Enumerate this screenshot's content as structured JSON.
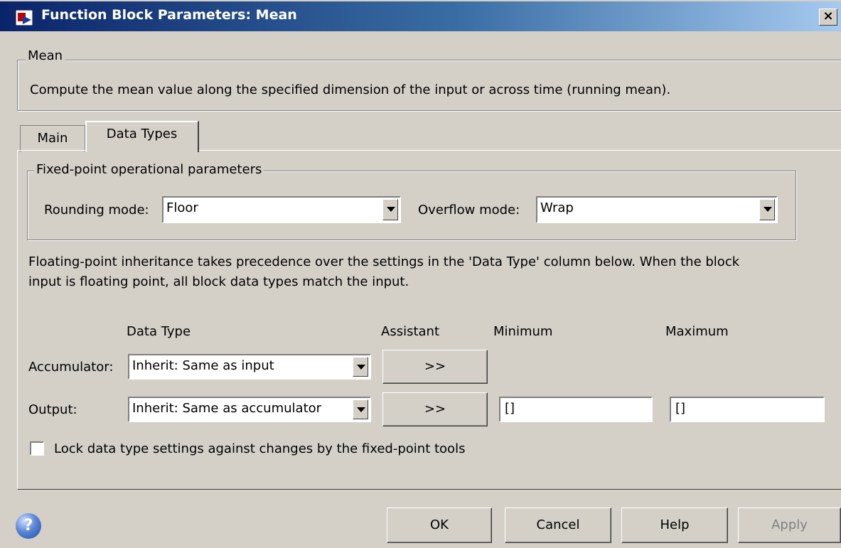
{
  "window": {
    "title": "Function Block Parameters: Mean",
    "close_glyph": "×"
  },
  "description_group": {
    "legend": "Mean",
    "text": "Compute the mean value along the specified dimension of the input or across time (running mean)."
  },
  "tabs": [
    {
      "label": "Main"
    },
    {
      "label": "Data Types"
    }
  ],
  "fixed_point": {
    "legend": "Fixed-point operational parameters",
    "rounding_label": "Rounding mode:",
    "rounding_value": "Floor",
    "overflow_label": "Overflow mode:",
    "overflow_value": "Wrap"
  },
  "info_text_line1": "Floating-point inheritance takes precedence over the settings in the 'Data Type' column below. When the block",
  "info_text_line2": "input is floating point, all block data types match the input.",
  "columns": {
    "data_type": "Data Type",
    "assistant": "Assistant",
    "minimum": "Minimum",
    "maximum": "Maximum"
  },
  "rows": {
    "accumulator": {
      "label": "Accumulator:",
      "data_type": "Inherit: Same as input",
      "assistant": ">>"
    },
    "output": {
      "label": "Output:",
      "data_type": "Inherit: Same as accumulator",
      "assistant": ">>",
      "minimum": "[]",
      "maximum": "[]"
    }
  },
  "lock_checkbox_label": "Lock data type settings against changes by the fixed-point tools",
  "buttons": {
    "help_glyph": "?",
    "ok": "OK",
    "cancel": "Cancel",
    "help": "Help",
    "apply": "Apply"
  },
  "colors": {
    "dialog_bg": "#d4d0c8",
    "titlebar_start": "#0a246a",
    "titlebar_end": "#a6caf0"
  }
}
